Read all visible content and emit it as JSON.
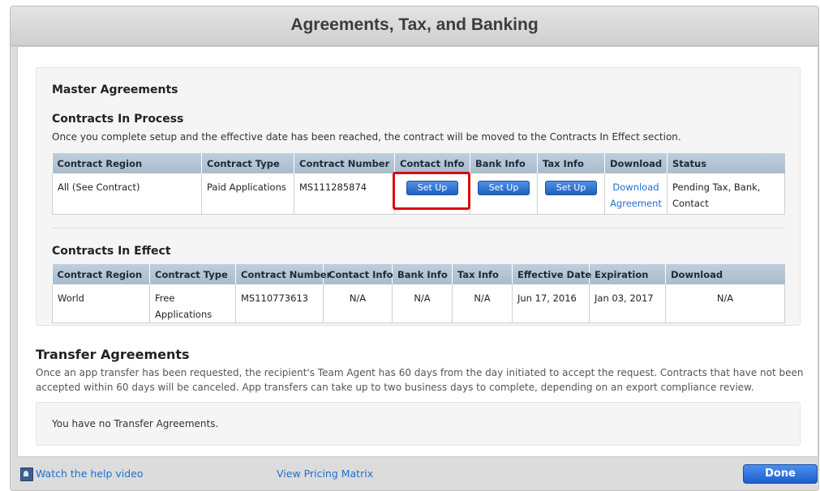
{
  "window": {
    "title": "Agreements, Tax, and Banking"
  },
  "master": {
    "heading": "Master Agreements",
    "in_process": {
      "heading": "Contracts In Process",
      "note": "Once you complete setup and the effective date has been reached, the contract will be moved to the Contracts In Effect section.",
      "columns": [
        "Contract Region",
        "Contract Type",
        "Contract Number",
        "Contact Info",
        "Bank Info",
        "Tax Info",
        "Download",
        "Status"
      ],
      "row": {
        "region": "All (See Contract)",
        "type": "Paid Applications",
        "number": "MS111285874",
        "contact_btn": "Set Up",
        "bank_btn": "Set Up",
        "tax_btn": "Set Up",
        "download_line1": "Download",
        "download_line2": "Agreement",
        "status_line1": "Pending Tax, Bank,",
        "status_line2": "Contact"
      }
    },
    "in_effect": {
      "heading": "Contracts In Effect",
      "columns": [
        "Contract Region",
        "Contract Type",
        "Contract Number",
        "Contact Info",
        "Bank Info",
        "Tax Info",
        "Effective Date",
        "Expiration",
        "Download"
      ],
      "row": {
        "region": "World",
        "type": "Free Applications",
        "number": "MS110773613",
        "contact": "N/A",
        "bank": "N/A",
        "tax": "N/A",
        "effective": "Jun 17, 2016",
        "expiration": "Jan 03, 2017",
        "download": "N/A"
      }
    }
  },
  "transfer": {
    "heading": "Transfer Agreements",
    "note_line1": "Once an app transfer has been requested, the recipient's Team Agent has 60 days from the day initiated to accept the request. Contracts that have not been",
    "note_line2": "accepted within 60 days will be canceled. App transfers can take up to two business days to complete, depending on an export compliance review.",
    "empty": "You have no Transfer Agreements."
  },
  "footer": {
    "help_icon": "video-icon",
    "help_link": "Watch the help video",
    "pricing_link": "View Pricing Matrix",
    "done": "Done"
  },
  "colors": {
    "highlight": "#d80c0c",
    "button_blue": "#1f5fbf",
    "link": "#1f6fcf",
    "table_header": "#bfcedd"
  }
}
